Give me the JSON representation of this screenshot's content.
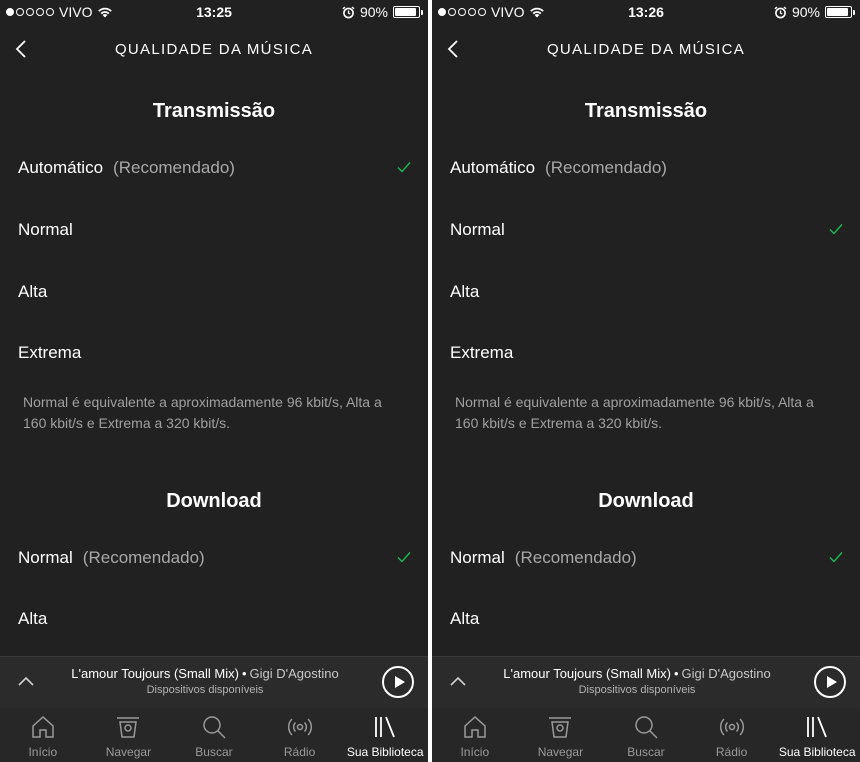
{
  "screens": [
    {
      "status": {
        "carrier": "VIVO",
        "time": "13:25",
        "battery": "90%",
        "battery_level": 0.9
      },
      "header": {
        "title": "QUALIDADE DA MÚSICA"
      },
      "streaming": {
        "heading": "Transmissão",
        "options": [
          {
            "label": "Automático",
            "note": "(Recomendado)",
            "selected": true
          },
          {
            "label": "Normal",
            "note": "",
            "selected": false
          },
          {
            "label": "Alta",
            "note": "",
            "selected": false
          },
          {
            "label": "Extrema",
            "note": "",
            "selected": false
          }
        ],
        "description": "Normal é equivalente a aproximadamente 96 kbit/s, Alta a 160 kbit/s e Extrema a 320 kbit/s."
      },
      "download": {
        "heading": "Download",
        "options": [
          {
            "label": "Normal",
            "note": "(Recomendado)",
            "selected": true
          },
          {
            "label": "Alta",
            "note": "",
            "selected": false
          }
        ]
      },
      "now_playing": {
        "title": "L'amour Toujours (Small Mix)",
        "separator": "•",
        "artist": "Gigi D'Agostino",
        "subtitle": "Dispositivos disponíveis"
      },
      "tabs": [
        {
          "label": "Início",
          "icon": "home-icon",
          "active": false
        },
        {
          "label": "Navegar",
          "icon": "browse-icon",
          "active": false
        },
        {
          "label": "Buscar",
          "icon": "search-icon",
          "active": false
        },
        {
          "label": "Rádio",
          "icon": "radio-icon",
          "active": false
        },
        {
          "label": "Sua Biblioteca",
          "icon": "library-icon",
          "active": true
        }
      ]
    },
    {
      "status": {
        "carrier": "VIVO",
        "time": "13:26",
        "battery": "90%",
        "battery_level": 0.9
      },
      "header": {
        "title": "QUALIDADE DA MÚSICA"
      },
      "streaming": {
        "heading": "Transmissão",
        "options": [
          {
            "label": "Automático",
            "note": "(Recomendado)",
            "selected": false
          },
          {
            "label": "Normal",
            "note": "",
            "selected": true
          },
          {
            "label": "Alta",
            "note": "",
            "selected": false
          },
          {
            "label": "Extrema",
            "note": "",
            "selected": false
          }
        ],
        "description": "Normal é equivalente a aproximadamente 96 kbit/s, Alta a 160 kbit/s e Extrema a 320 kbit/s."
      },
      "download": {
        "heading": "Download",
        "options": [
          {
            "label": "Normal",
            "note": "(Recomendado)",
            "selected": true
          },
          {
            "label": "Alta",
            "note": "",
            "selected": false
          }
        ]
      },
      "now_playing": {
        "title": "L'amour Toujours (Small Mix)",
        "separator": "•",
        "artist": "Gigi D'Agostino",
        "subtitle": "Dispositivos disponíveis"
      },
      "tabs": [
        {
          "label": "Início",
          "icon": "home-icon",
          "active": false
        },
        {
          "label": "Navegar",
          "icon": "browse-icon",
          "active": false
        },
        {
          "label": "Buscar",
          "icon": "search-icon",
          "active": false
        },
        {
          "label": "Rádio",
          "icon": "radio-icon",
          "active": false
        },
        {
          "label": "Sua Biblioteca",
          "icon": "library-icon",
          "active": true
        }
      ]
    }
  ],
  "colors": {
    "background": "#212121",
    "accent_check": "#1db954",
    "secondary_text": "#a8a8a8"
  }
}
